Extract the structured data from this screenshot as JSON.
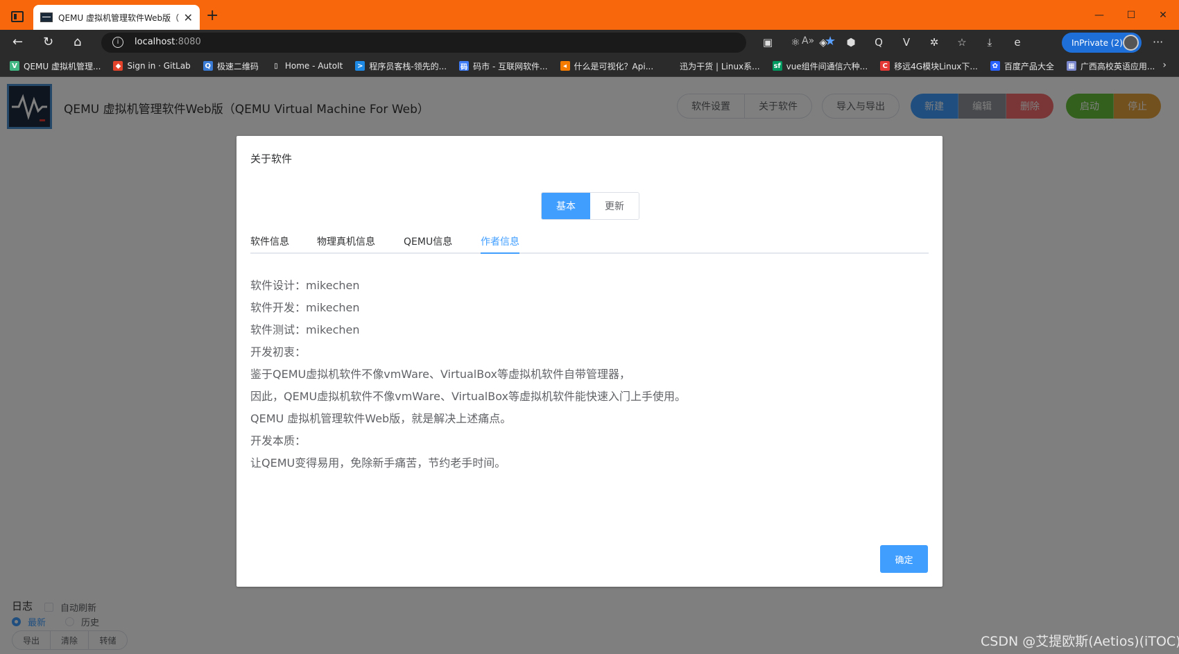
{
  "browser": {
    "tab_title": "QEMU 虚拟机管理软件Web版（",
    "url_host": "localhost",
    "url_port": ":8080",
    "inprivate_label": "InPrivate (2)",
    "extensions": [
      {
        "icon": "puzzle-badge-icon",
        "glyph": "▣"
      },
      {
        "icon": "react-icon",
        "glyph": "⚛"
      },
      {
        "icon": "paint-badge-icon",
        "glyph": "◈"
      },
      {
        "icon": "hexagon-badge-icon",
        "glyph": "⬢"
      },
      {
        "icon": "q-app-icon",
        "glyph": "Q"
      },
      {
        "icon": "vue-icon",
        "glyph": "V"
      },
      {
        "icon": "extensions-icon",
        "glyph": "✲"
      },
      {
        "icon": "favorites-icon",
        "glyph": "☆"
      },
      {
        "icon": "download-icon",
        "glyph": "⤓"
      },
      {
        "icon": "edge-icon",
        "glyph": "e"
      }
    ],
    "bookmarks": [
      {
        "label": "QEMU 虚拟机管理...",
        "color": "#41b883",
        "glyph": "V"
      },
      {
        "label": "Sign in · GitLab",
        "color": "#e2432a",
        "glyph": "◆"
      },
      {
        "label": "极速二维码",
        "color": "#3a7bd5",
        "glyph": "Q"
      },
      {
        "label": "Home - AutoIt",
        "color": "#2b2b2b",
        "glyph": "▯"
      },
      {
        "label": "程序员客栈-领先的...",
        "color": "#1e88e5",
        "glyph": ">"
      },
      {
        "label": "码市 - 互联网软件...",
        "color": "#3d7bf7",
        "glyph": "码"
      },
      {
        "label": "什么是可视化？Api...",
        "color": "#f57c00",
        "glyph": "◂"
      },
      {
        "label": "迅为干货 | Linux系...",
        "color": "#2b2b2b",
        "glyph": ""
      },
      {
        "label": "vue组件间通信六种...",
        "color": "#009a61",
        "glyph": "sf"
      },
      {
        "label": "移远4G模块Linux下...",
        "color": "#e53935",
        "glyph": "C"
      },
      {
        "label": "百度产品大全",
        "color": "#2962ff",
        "glyph": "✿"
      },
      {
        "label": "广西高校英语应用...",
        "color": "#7986cb",
        "glyph": "▦"
      }
    ]
  },
  "app": {
    "title": "QEMU 虚拟机管理软件Web版（QEMU Virtual Machine For Web）",
    "toolbar": {
      "settings": "软件设置",
      "about": "关于软件",
      "import_export": "导入与导出",
      "new": "新建",
      "edit": "编辑",
      "delete": "删除",
      "start": "启动",
      "stop": "停止"
    },
    "log": {
      "title": "日志",
      "auto_refresh": "自动刷新",
      "latest": "最新",
      "history": "历史",
      "export": "导出",
      "clear": "清除",
      "dump": "转储"
    }
  },
  "dialog": {
    "title": "关于软件",
    "segments": [
      "基本",
      "更新"
    ],
    "tabs": [
      "软件信息",
      "物理真机信息",
      "QEMU信息",
      "作者信息"
    ],
    "active_tab": 3,
    "lines": [
      "软件设计：mikechen",
      "软件开发：mikechen",
      "软件测试：mikechen",
      "开发初衷：",
      "鉴于QEMU虚拟机软件不像vmWare、VirtualBox等虚拟机软件自带管理器，",
      "因此，QEMU虚拟机软件不像vmWare、VirtualBox等虚拟机软件能快速入门上手使用。",
      "QEMU 虚拟机管理软件Web版，就是解决上述痛点。",
      "开发本质：",
      "让QEMU变得易用，免除新手痛苦，节约老手时间。"
    ],
    "ok": "确定"
  },
  "watermark": "CSDN @艾提欧斯(Aetios)(iTOC)",
  "colors": {
    "browser_frame": "#f8670c",
    "primary": "#409eff",
    "success": "#67c23a",
    "warning": "#e6a23c",
    "danger": "#f56c6c",
    "info": "#909399"
  }
}
